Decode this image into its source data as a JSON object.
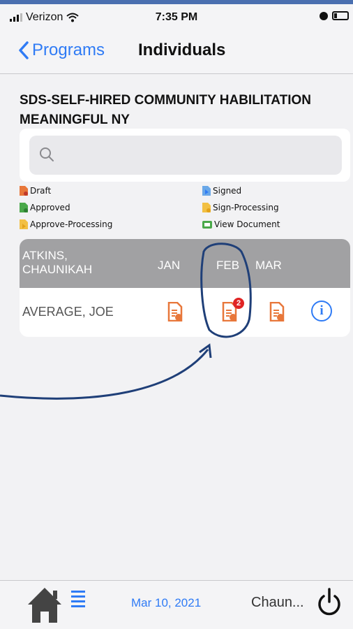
{
  "status_bar": {
    "carrier": "Verizon",
    "time": "7:35 PM"
  },
  "nav": {
    "back_label": "Programs",
    "title": "Individuals"
  },
  "program_title": "SDS-SELF-HIRED COMMUNITY HABILITATION MEANINGFUL NY",
  "search": {
    "placeholder": "",
    "value": ""
  },
  "legend": {
    "draft": "Draft",
    "approved": "Approved",
    "approve_processing": "Approve-Processing",
    "signed": "Signed",
    "sign_processing": "Sign-Processing",
    "view_document": "View Document"
  },
  "table": {
    "header_name": "ATKINS, CHAUNIKAH",
    "months": [
      "JAN",
      "FEB",
      "MAR"
    ],
    "row": {
      "name": "AVERAGE, JOE",
      "feb_badge": "2"
    }
  },
  "tabbar": {
    "date": "Mar 10, 2021",
    "user": "Chaun..."
  },
  "colors": {
    "accent_blue": "#2f7bf5",
    "draft_orange": "#e8773a",
    "approved_green": "#4aa84a",
    "processing_yellow": "#f2c043",
    "signed_blue": "#6aa8e8",
    "header_gray": "#a1a1a3",
    "annotation_ink": "#1f3f78"
  },
  "icons": [
    "search-icon",
    "chevron-left-icon",
    "home-icon",
    "menu-icon",
    "power-icon",
    "info-icon",
    "document-draft-icon"
  ]
}
